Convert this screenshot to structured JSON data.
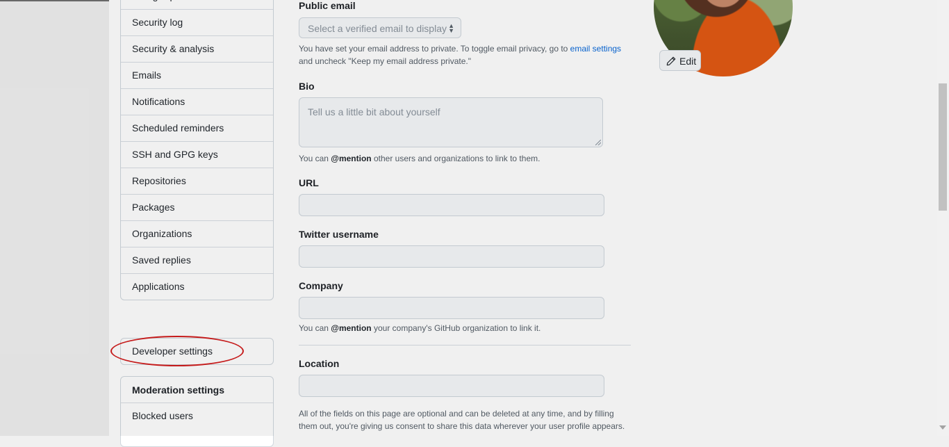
{
  "sidebar": {
    "items": [
      {
        "label": "Billing & plans"
      },
      {
        "label": "Security log"
      },
      {
        "label": "Security & analysis"
      },
      {
        "label": "Emails"
      },
      {
        "label": "Notifications"
      },
      {
        "label": "Scheduled reminders"
      },
      {
        "label": "SSH and GPG keys"
      },
      {
        "label": "Repositories"
      },
      {
        "label": "Packages"
      },
      {
        "label": "Organizations"
      },
      {
        "label": "Saved replies"
      },
      {
        "label": "Applications"
      }
    ],
    "developer_settings": "Developer settings",
    "moderation": {
      "heading": "Moderation settings",
      "items": [
        {
          "label": "Blocked users"
        }
      ]
    }
  },
  "form": {
    "public_email": {
      "label": "Public email",
      "select_placeholder": "Select a verified email to display",
      "note_text": "You have set your email address to private. To toggle email privacy, go to ",
      "note_link": "email settings",
      "note_text2": "and uncheck \"Keep my email address private.\""
    },
    "bio": {
      "label": "Bio",
      "placeholder": "Tell us a little bit about yourself",
      "note_prefix": "You can ",
      "note_mention": "@mention",
      "note_suffix": " other users and organizations to link to them."
    },
    "url": {
      "label": "URL"
    },
    "twitter": {
      "label": "Twitter username"
    },
    "company": {
      "label": "Company",
      "note_prefix": "You can ",
      "note_mention": "@mention",
      "note_suffix": " your company's GitHub organization to link it."
    },
    "location": {
      "label": "Location"
    },
    "footer_note_line1": "All of the fields on this page are optional and can be deleted at any time, and by filling",
    "footer_note_line2": "them out, you're giving us consent to share this data wherever your user profile appears."
  },
  "avatar": {
    "edit_label": "Edit"
  },
  "colors": {
    "link": "#0969da",
    "highlight": "#d21d1d"
  }
}
